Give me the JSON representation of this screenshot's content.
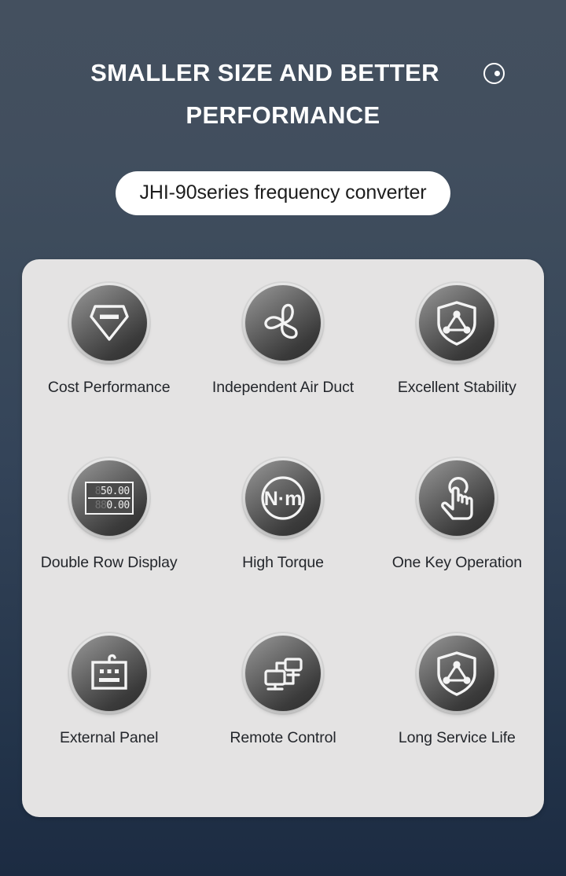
{
  "header": {
    "title_line_1": "SMALLER SIZE AND BETTER",
    "title_line_2": "PERFORMANCE",
    "mark_icon": "circle-dot-icon"
  },
  "subtitle": {
    "text": "JHI-90series frequency converter"
  },
  "colors": {
    "background_top": "#44505f",
    "background_bottom": "#1c2b42",
    "card": "#e4e3e3",
    "pill_background": "#ffffff",
    "pill_text": "#1d1d1d",
    "title_text": "#ffffff",
    "label_text": "#23262b",
    "bubble_light": "#9a9a9a",
    "bubble_dark": "#2c2c2c"
  },
  "features": [
    [
      {
        "label": "Cost Performance",
        "icon": "diamond-gem-icon"
      },
      {
        "label": "Independent Air Duct",
        "icon": "fan-blades-icon"
      },
      {
        "label": "Excellent Stability",
        "icon": "shield-network-icon"
      }
    ],
    [
      {
        "label": "Double Row Display",
        "icon": "seven-segment-display-icon",
        "display": {
          "row1_value": "50.00",
          "row1_ghost": "8",
          "row2_value": "0.00",
          "row2_ghost": "88"
        }
      },
      {
        "label": "High Torque",
        "icon": "newton-meter-icon",
        "unit_text": "N·m"
      },
      {
        "label": "One Key Operation",
        "icon": "hand-tap-icon"
      }
    ],
    [
      {
        "label": "External Panel",
        "icon": "control-panel-icon"
      },
      {
        "label": "Remote Control",
        "icon": "network-computers-icon"
      },
      {
        "label": "Long Service Life",
        "icon": "shield-network-icon"
      }
    ]
  ]
}
